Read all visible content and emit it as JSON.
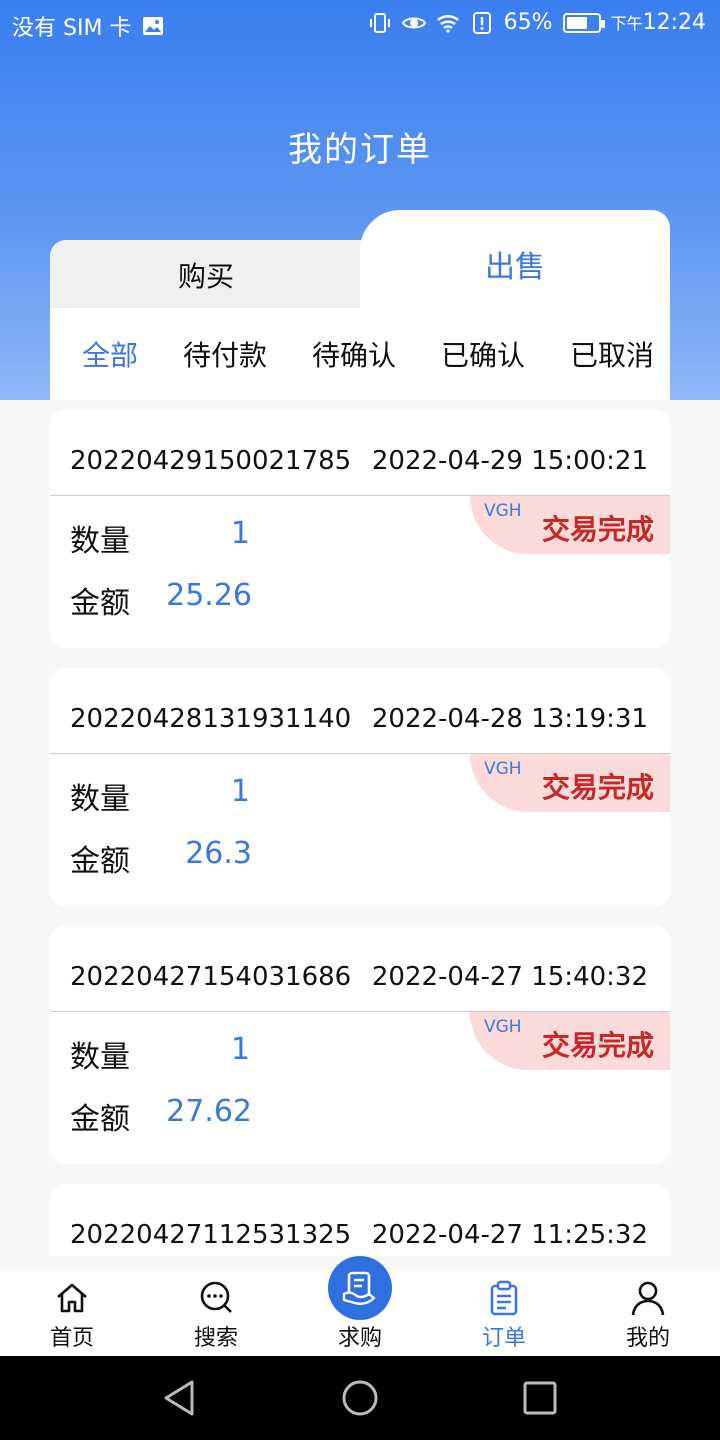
{
  "status_bar": {
    "carrier": "没有 SIM 卡",
    "battery": "65%",
    "battery_level": 0.65,
    "time_prefix": "下午",
    "time": "12:24"
  },
  "header": {
    "title": "我的订单"
  },
  "tabs": [
    {
      "label": "购买",
      "active": false
    },
    {
      "label": "出售",
      "active": true
    }
  ],
  "filters": [
    {
      "label": "全部",
      "active": true
    },
    {
      "label": "待付款",
      "active": false
    },
    {
      "label": "待确认",
      "active": false
    },
    {
      "label": "已确认",
      "active": false
    },
    {
      "label": "已取消",
      "active": false
    }
  ],
  "labels": {
    "quantity": "数量",
    "amount": "金额"
  },
  "orders": [
    {
      "order_no": "20220429150021785",
      "time": "2022-04-29 15:00:21",
      "code": "VGH",
      "status": "交易完成",
      "quantity": "1",
      "amount": "25.26"
    },
    {
      "order_no": "20220428131931140",
      "time": "2022-04-28 13:19:31",
      "code": "VGH",
      "status": "交易完成",
      "quantity": "1",
      "amount": "26.3"
    },
    {
      "order_no": "20220427154031686",
      "time": "2022-04-27 15:40:32",
      "code": "VGH",
      "status": "交易完成",
      "quantity": "1",
      "amount": "27.62"
    },
    {
      "order_no": "20220427112531325",
      "time": "2022-04-27 11:25:32"
    }
  ],
  "bottom_nav": [
    {
      "label": "首页",
      "icon": "home-icon"
    },
    {
      "label": "搜索",
      "icon": "search-chat-icon"
    },
    {
      "label": "求购",
      "icon": "handshake-icon"
    },
    {
      "label": "订单",
      "icon": "clipboard-icon",
      "active": true
    },
    {
      "label": "我的",
      "icon": "user-icon"
    }
  ],
  "colors": {
    "accent": "#3a78e0",
    "status_red": "#c62828",
    "badge_bg": "#fbdada"
  }
}
